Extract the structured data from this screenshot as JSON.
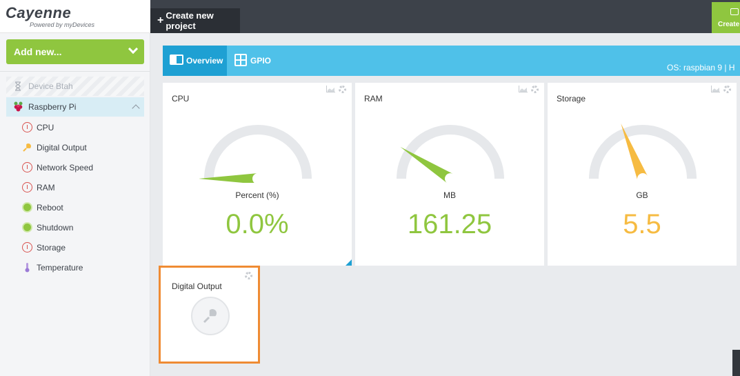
{
  "brand": {
    "title": "Cayenne",
    "subtitle": "Powered by myDevices"
  },
  "topbar": {
    "create_project_label": "Create new project",
    "create_label": "Create"
  },
  "sidebar": {
    "add_new_label": "Add new...",
    "devices": [
      {
        "label": "Device Btah",
        "state": "inactive"
      },
      {
        "label": "Raspberry Pi",
        "state": "selected"
      }
    ],
    "widgets": [
      {
        "label": "CPU",
        "icon": "gauge-icon"
      },
      {
        "label": "Digital Output",
        "icon": "light-bulb-icon"
      },
      {
        "label": "Network Speed",
        "icon": "gauge-icon"
      },
      {
        "label": "RAM",
        "icon": "gauge-icon"
      },
      {
        "label": "Reboot",
        "icon": "green-dot-icon"
      },
      {
        "label": "Shutdown",
        "icon": "green-dot-icon"
      },
      {
        "label": "Storage",
        "icon": "gauge-icon"
      },
      {
        "label": "Temperature",
        "icon": "thermometer-icon"
      }
    ]
  },
  "tabs": [
    {
      "label": "Overview",
      "active": true
    },
    {
      "label": "GPIO",
      "active": false
    }
  ],
  "os_info": "OS: raspbian 9   |   H",
  "cards": [
    {
      "title": "CPU",
      "unit": "Percent (%)",
      "value": "0.0%",
      "color": "#8fc63f",
      "fraction": 0.0
    },
    {
      "title": "RAM",
      "unit": "MB",
      "value": "161.25",
      "color": "#8fc63f",
      "fraction": 0.18
    },
    {
      "title": "Storage",
      "unit": "GB",
      "value": "5.5",
      "color": "#f6bb42",
      "fraction": 0.38
    }
  ],
  "digital_output": {
    "title": "Digital Output"
  },
  "colors": {
    "accent_green": "#8fc63f",
    "tab_blue": "#4fc1e9",
    "tab_active": "#1ea0d3",
    "highlight_orange": "#ef8b33"
  }
}
